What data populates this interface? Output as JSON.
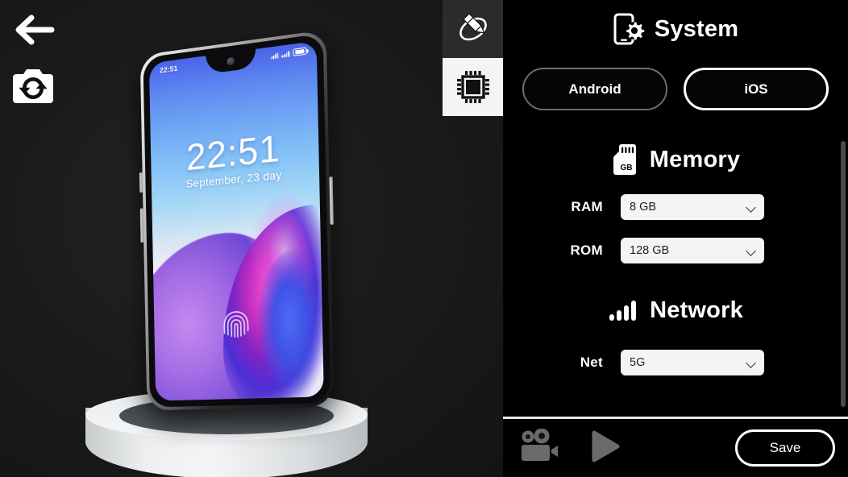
{
  "viewport": {
    "back_icon": "arrow-left-icon",
    "reset_camera_icon": "camera-reset-icon",
    "phone": {
      "status_time": "22:51",
      "lock_time": "22:51",
      "lock_date": "September, 23 day",
      "fingerprint_icon": "fingerprint-icon",
      "battery_icon": "battery-full-icon",
      "signal_icon": "signal-bars-icon"
    }
  },
  "tabs": [
    {
      "id": "edit",
      "icon": "pencil-orbit-icon",
      "selected": false
    },
    {
      "id": "hardware",
      "icon": "cpu-chip-icon",
      "selected": true
    }
  ],
  "panel": {
    "system": {
      "icon": "phone-gear-icon",
      "title": "System",
      "options": [
        {
          "label": "Android",
          "selected": false
        },
        {
          "label": "iOS",
          "selected": true
        }
      ]
    },
    "memory": {
      "icon": "sd-card-gb-icon",
      "title": "Memory",
      "fields": [
        {
          "label": "RAM",
          "value": "8 GB",
          "chevron": "chevron-down-icon"
        },
        {
          "label": "ROM",
          "value": "128 GB",
          "chevron": "chevron-down-icon"
        }
      ]
    },
    "network": {
      "icon": "signal-bars-icon",
      "title": "Network",
      "fields": [
        {
          "label": "Net",
          "value": "5G",
          "chevron": "chevron-down-icon"
        }
      ]
    }
  },
  "bottom_bar": {
    "record_icon": "video-camera-icon",
    "play_icon": "play-icon",
    "save_label": "Save"
  },
  "colors": {
    "panel_bg": "#000000",
    "viewport_bg": "#1b1b1b",
    "select_bg": "#f4f4f4",
    "accent_white": "#ffffff",
    "inactive_gray": "#6e6e6e",
    "icon_gray": "#6a6a6a"
  }
}
